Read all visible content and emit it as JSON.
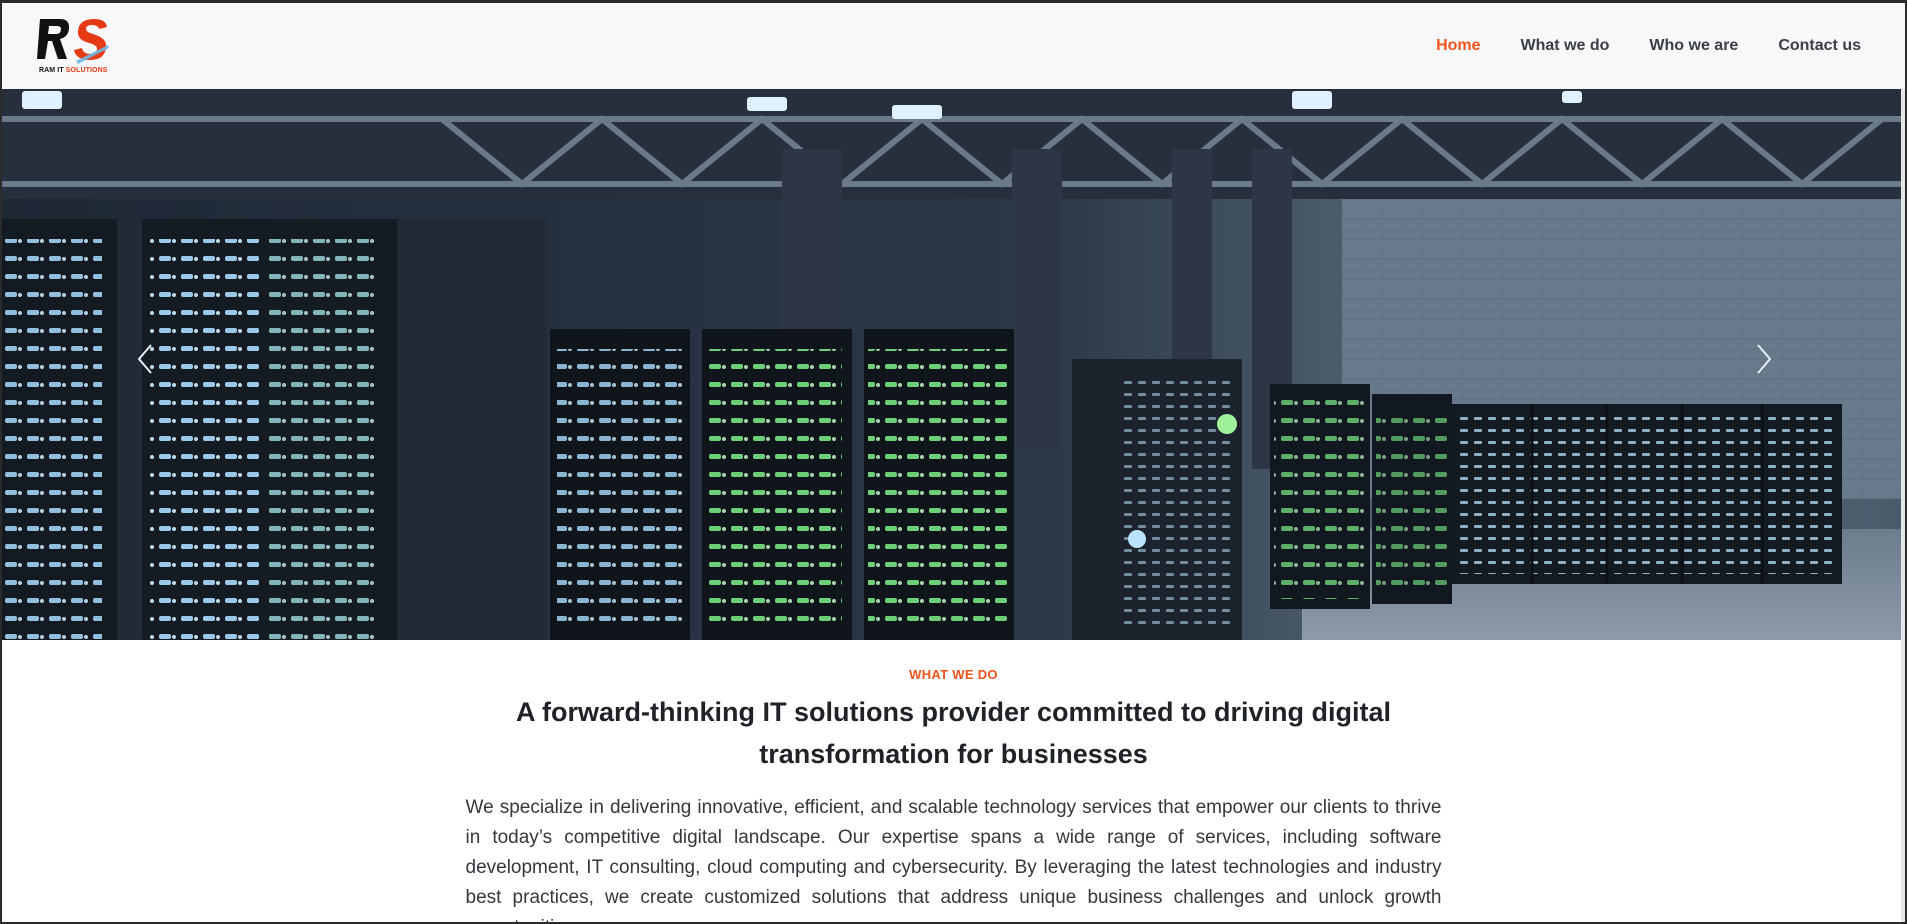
{
  "brand": {
    "logo_mark": "RS",
    "logo_word_1": "RAM",
    "logo_word_2": "IT",
    "logo_word_3": "SOLUTIONS",
    "accent_color": "#f0531c"
  },
  "nav": {
    "items": [
      {
        "label": "Home",
        "active": true
      },
      {
        "label": "What we do",
        "active": false
      },
      {
        "label": "Who we are",
        "active": false
      },
      {
        "label": "Contact us",
        "active": false
      }
    ]
  },
  "hero": {
    "image_subject": "server-racks-datacenter",
    "prev_icon": "chevron-left-icon",
    "next_icon": "chevron-right-icon"
  },
  "section": {
    "eyebrow": "WHAT WE DO",
    "headline": "A forward-thinking IT solutions provider committed to driving digital transformation for businesses",
    "body": "We specialize in delivering innovative, efficient, and scalable technology services that empower our clients to thrive in today’s competitive digital landscape. Our expertise spans a wide range of services, including software development, IT consulting, cloud computing and cybersecurity. By leveraging the latest technologies and industry best practices, we create customized solutions that address unique business challenges and unlock growth opportunities."
  }
}
